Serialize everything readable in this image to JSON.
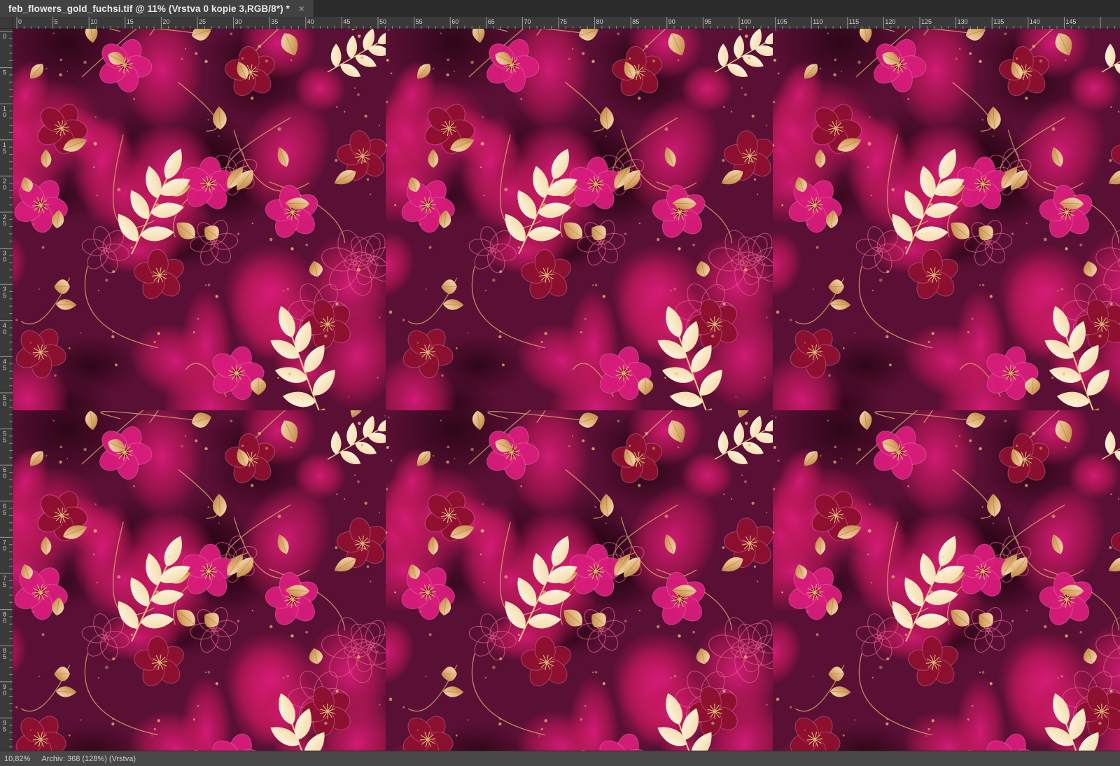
{
  "document": {
    "tab_title": "feb_flowers_gold_fuchsi.tif @ 11% (Vrstva 0 kopie 3,RGB/8*) *",
    "close_glyph": "×"
  },
  "rulers": {
    "horizontal_labels": [
      "0",
      "5",
      "10",
      "15",
      "20",
      "25",
      "30",
      "35",
      "40",
      "45",
      "50",
      "55",
      "60",
      "65",
      "70",
      "75",
      "80",
      "85",
      "90",
      "95",
      "100",
      "105",
      "110",
      "115",
      "120",
      "125",
      "130",
      "135",
      "140",
      "145"
    ],
    "vertical_labels": [
      "0",
      "5",
      "10",
      "15",
      "20",
      "25",
      "30",
      "35",
      "40",
      "45",
      "50",
      "55",
      "60",
      "65",
      "70",
      "75",
      "80",
      "85",
      "90",
      "95"
    ]
  },
  "artwork": {
    "description_colors": {
      "background": "#5a0f34",
      "fuchsia": "#c2185b",
      "magenta": "#d81b7a",
      "crimson": "#8e0f2e",
      "gold": "#e0b070",
      "cream": "#f4dcae",
      "shadow": "#2a0515"
    }
  },
  "status": {
    "zoom": "10,82%",
    "doc_info": "Archiv: 368 (128%) (Vrstva)"
  }
}
